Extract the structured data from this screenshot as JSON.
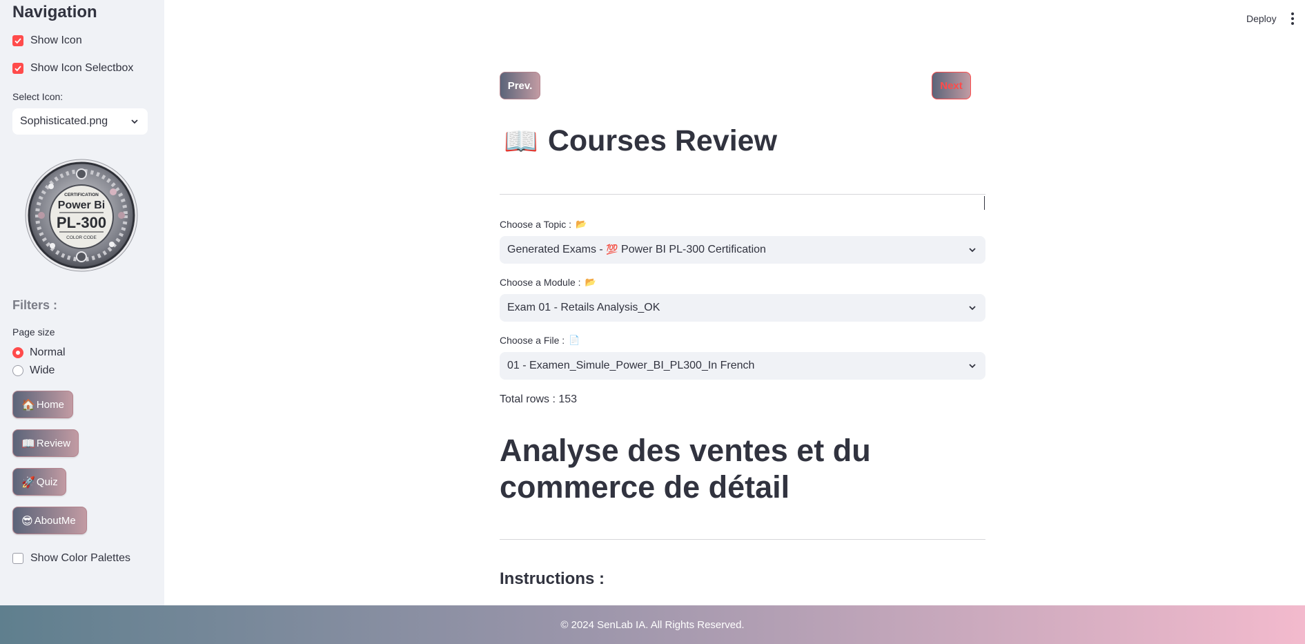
{
  "sidebar": {
    "title": "Navigation",
    "show_icon_label": "Show Icon",
    "show_icon_selectbox_label": "Show Icon Selectbox",
    "select_icon_label": "Select Icon:",
    "select_icon_value": "Sophisticated.png",
    "badge": {
      "line1": "CERTIFICATION",
      "line2": "Power Bi",
      "line3": "PL-300",
      "line4": "COLOR CODE"
    },
    "filters_title": "Filters :",
    "page_size_label": "Page size",
    "page_size_options": [
      "Normal",
      "Wide"
    ],
    "page_size_selected": "Normal",
    "buttons": [
      {
        "icon": "🏠",
        "label": "Home"
      },
      {
        "icon": "📖",
        "label": "Review"
      },
      {
        "icon": "🚀",
        "label": "Quiz"
      },
      {
        "icon": "😎",
        "label": "AboutMe"
      }
    ],
    "show_color_palettes_label": "Show Color Palettes"
  },
  "header": {
    "deploy_label": "Deploy"
  },
  "main": {
    "prev_label": "Prev.",
    "next_label": "Next",
    "title_icon": "📖",
    "title": "Courses Review",
    "topic": {
      "label": "Choose a Topic :",
      "icon": "📂",
      "value_prefix": "Generated Exams - ",
      "value_icon": "💯",
      "value_suffix": " Power BI PL-300 Certification"
    },
    "module": {
      "label": "Choose a Module :",
      "icon": "📂",
      "value": "Exam 01 - Retails Analysis_OK"
    },
    "file": {
      "label": "Choose a File :",
      "icon": "📄",
      "value": "01 - Examen_Simule_Power_BI_PL300_In French"
    },
    "total_rows": "Total rows : 153",
    "heading": "Analyse des ventes et du commerce de détail",
    "instructions": "Instructions :"
  },
  "footer": {
    "text": "© 2024 SenLab IA. All Rights Reserved."
  },
  "colors": {
    "accent": "#ff4b4b",
    "sidebar_bg": "#f0f2f6",
    "text": "#31333f"
  }
}
